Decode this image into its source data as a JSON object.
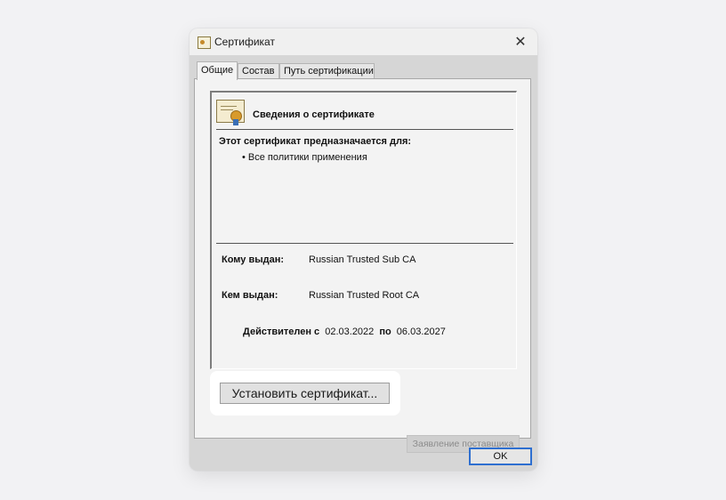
{
  "window": {
    "title": "Сертификат",
    "icon": "certificate-icon",
    "close_glyph": "✕"
  },
  "tabs": [
    {
      "label": "Общие",
      "active": true
    },
    {
      "label": "Состав",
      "active": false
    },
    {
      "label": "Путь сертификации",
      "active": false
    }
  ],
  "general": {
    "heading": "Сведения о сертификате",
    "purpose_title": "Этот сертификат предназначается для:",
    "purposes": [
      "• Все политики применения"
    ],
    "issued_to_label": "Кому выдан:",
    "issued_to_value": "Russian Trusted Sub CA",
    "issued_by_label": "Кем выдан:",
    "issued_by_value": "Russian Trusted Root CA",
    "valid_from_label": "Действителен с",
    "valid_from": "02.03.2022",
    "valid_to_label": "по",
    "valid_to": "06.03.2027"
  },
  "buttons": {
    "install": "Установить сертификат...",
    "issuer_statement": "Заявление поставщика",
    "ok": "OK"
  },
  "colors": {
    "ok_focus_border": "#2e6fd0",
    "highlight": "#ffffff"
  }
}
